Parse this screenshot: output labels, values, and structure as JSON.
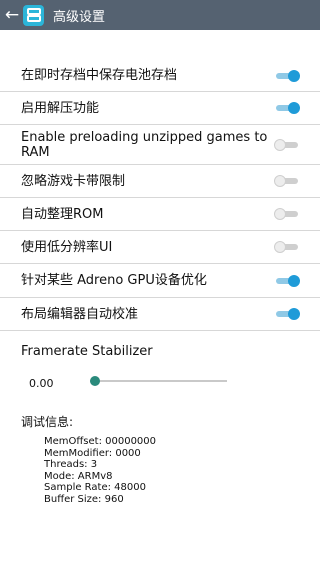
{
  "header": {
    "back_icon": "arrow-left-icon",
    "app_icon": "app-icon",
    "title": "高级设置",
    "bar_color": "#556271",
    "accent": "#1f9bd8"
  },
  "settings": [
    {
      "label": "在即时存档中保存电池存档",
      "enabled": true
    },
    {
      "label": "启用解压功能",
      "enabled": true
    },
    {
      "label": "Enable preloading unzipped games to RAM",
      "enabled": false
    },
    {
      "label": "忽略游戏卡带限制",
      "enabled": false
    },
    {
      "label": "自动整理ROM",
      "enabled": false
    },
    {
      "label": "使用低分辨率UI",
      "enabled": false
    },
    {
      "label": "针对某些 Adreno GPU设备优化",
      "enabled": true
    },
    {
      "label": "布局编辑器自动校准",
      "enabled": true
    }
  ],
  "framerate": {
    "label": "Framerate Stabilizer",
    "value": "0.00",
    "fraction": 0.0
  },
  "debug": {
    "title": "调试信息:",
    "lines": [
      "MemOffset: 00000000",
      "MemModifier: 0000",
      "Threads: 3",
      "Mode: ARMv8",
      "Sample Rate: 48000",
      "Buffer Size: 960"
    ]
  }
}
